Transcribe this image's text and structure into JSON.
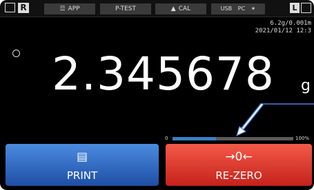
{
  "status_bar": {
    "r_label": "R",
    "app_label": "APP",
    "ptest_label": "P-TEST",
    "cal_label": "CAL",
    "usb_label": "USB",
    "pc_label": "PC",
    "l_label": "L"
  },
  "info": {
    "capacity": "6.2g/0.001m",
    "datetime": "2021/01/12  12:3"
  },
  "display": {
    "weight": "2.345678",
    "unit": "g"
  },
  "capacity_bar": {
    "min_label": "0",
    "max_label": "100%",
    "fill_percent": 36
  },
  "buttons": {
    "print_label": "PRINT",
    "rezero_icon": "→0←",
    "rezero_label": "RE-ZERO"
  },
  "colors": {
    "print_button": "#2f6fd0",
    "rezero_button": "#e0392d",
    "bar_fill": "#3a7fc6",
    "annotation_arrow": "#4a7fd8"
  }
}
